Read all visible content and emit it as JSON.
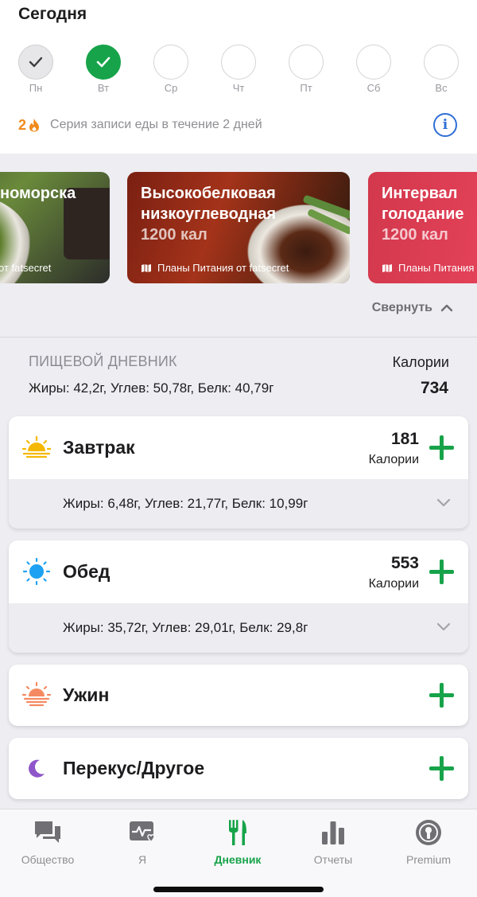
{
  "header": {
    "title": "Сегодня"
  },
  "week": [
    {
      "label": "Пн",
      "state": "done-light"
    },
    {
      "label": "Вт",
      "state": "done-green"
    },
    {
      "label": "Ср",
      "state": "empty"
    },
    {
      "label": "Чт",
      "state": "empty"
    },
    {
      "label": "Пт",
      "state": "empty"
    },
    {
      "label": "Сб",
      "state": "empty"
    },
    {
      "label": "Вс",
      "state": "empty"
    }
  ],
  "streak": {
    "count": "2",
    "icon": "flame-icon",
    "text": "Серия записи еды в течение 2 дней",
    "info_icon": "info-icon"
  },
  "banners": [
    {
      "title_line1": "номорска",
      "title_line2": "",
      "kcal": "",
      "footer": "от fatsecret"
    },
    {
      "title_line1": "Высокобелковая",
      "title_line2": "низкоуглеводная",
      "kcal": "1200 кал",
      "footer": "Планы Питания от fatsecret"
    },
    {
      "title_line1": "Интервал",
      "title_line2": "голодание",
      "kcal": "1200 кал",
      "footer": "Планы Питания"
    }
  ],
  "collapse_label": "Свернуть",
  "diary": {
    "heading": "ПИЩЕВОЙ ДНЕВНИК",
    "macros": "Жиры: 42,2г, Углев: 50,78г, Белк: 40,79г",
    "calories_label": "Калории",
    "calories_total": "734"
  },
  "meals": [
    {
      "name": "Завтрак",
      "icon": "sunrise-icon",
      "calories": "181",
      "calories_label": "Калории",
      "macros": "Жиры: 6,48г, Углев: 21,77г, Белк: 10,99г"
    },
    {
      "name": "Обед",
      "icon": "sun-icon",
      "calories": "553",
      "calories_label": "Калории",
      "macros": "Жиры: 35,72г, Углев: 29,01г, Белк: 29,8г"
    },
    {
      "name": "Ужин",
      "icon": "sunset-icon",
      "calories": "",
      "calories_label": "",
      "macros": ""
    },
    {
      "name": "Перекус/Другое",
      "icon": "moon-icon",
      "calories": "",
      "calories_label": "",
      "macros": ""
    }
  ],
  "tabs": [
    {
      "label": "Общество",
      "icon": "chat-icon",
      "active": false
    },
    {
      "label": "Я",
      "icon": "heart-pulse-icon",
      "active": false
    },
    {
      "label": "Дневник",
      "icon": "fork-knife-icon",
      "active": true
    },
    {
      "label": "Отчеты",
      "icon": "bar-chart-icon",
      "active": false
    },
    {
      "label": "Premium",
      "icon": "premium-badge-icon",
      "active": false
    }
  ],
  "colors": {
    "accent_green": "#17a34a",
    "streak_orange": "#f08a1c",
    "info_blue": "#2f6fd6"
  }
}
